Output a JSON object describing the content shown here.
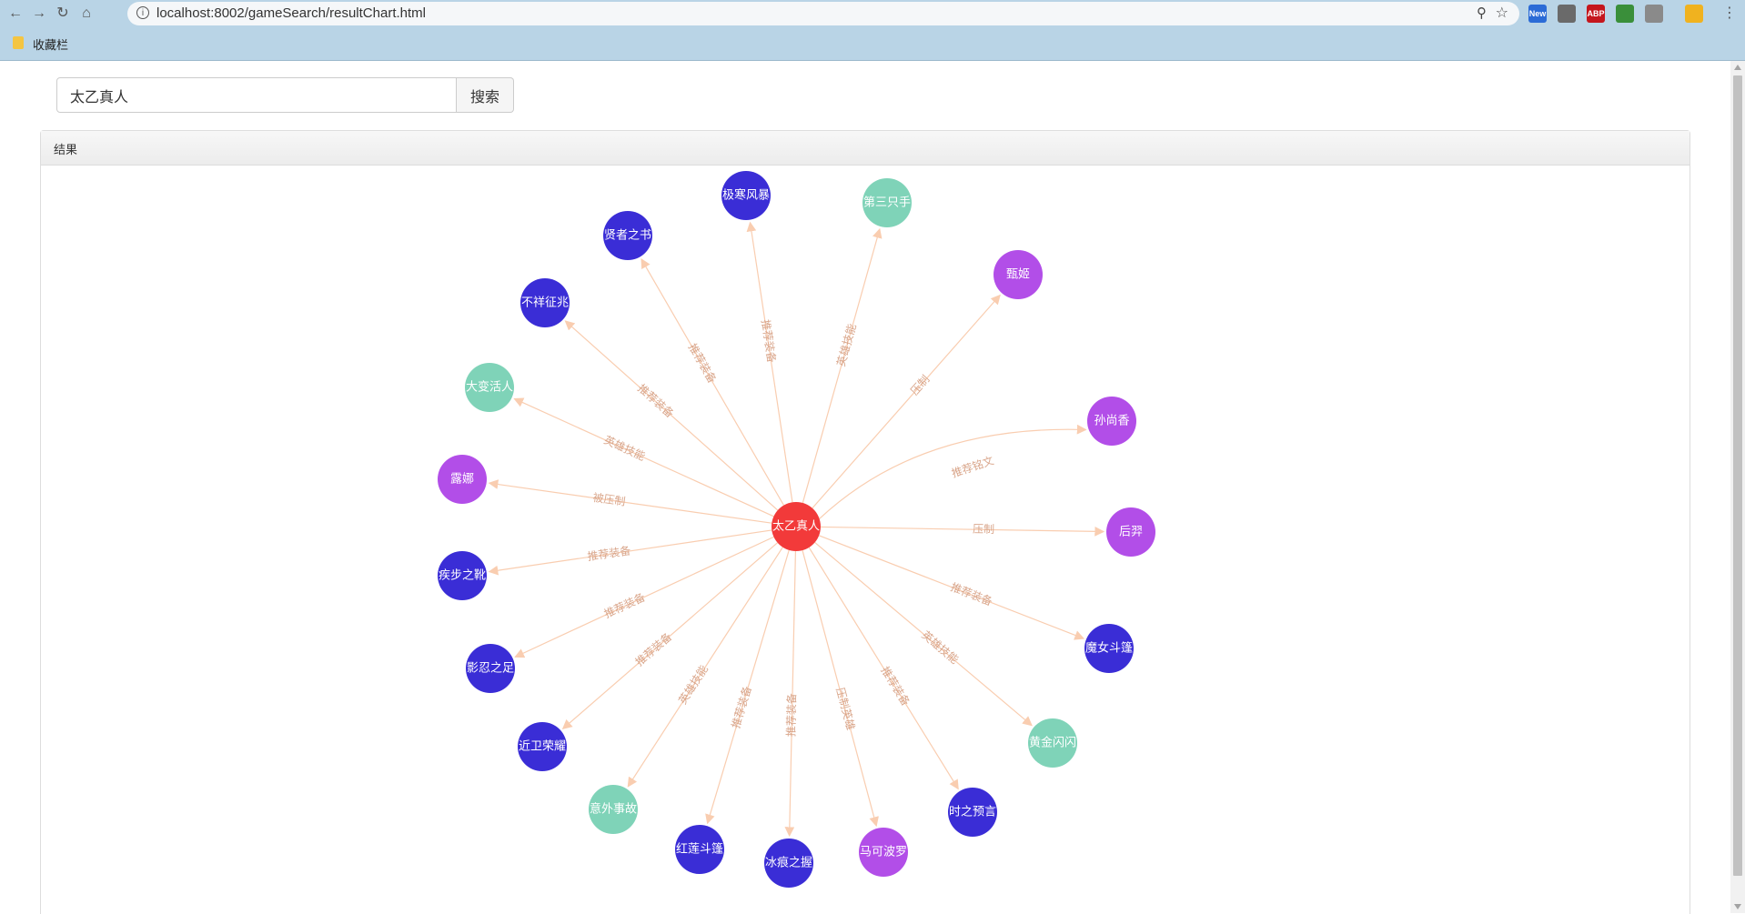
{
  "browser": {
    "url": "localhost:8002/gameSearch/resultChart.html",
    "bookmarks_folder": "收藏栏",
    "extensions": [
      {
        "name": "new-extension",
        "label": "New",
        "color": "#2b6bd6"
      },
      {
        "name": "chat-extension",
        "label": "",
        "color": "#6a6a6a"
      },
      {
        "name": "adblock-extension",
        "label": "ABP",
        "color": "#c5161d"
      },
      {
        "name": "globe-extension",
        "label": "",
        "color": "#3a8f3a"
      },
      {
        "name": "pdf-extension",
        "label": "",
        "color": "#8a8a8a"
      },
      {
        "name": "emoji-extension",
        "label": "",
        "color": "#f0b21f"
      }
    ]
  },
  "search": {
    "query": "太乙真人",
    "button_label": "搜索"
  },
  "panel": {
    "title": "结果"
  },
  "colors": {
    "center": "#f23a3a",
    "blue": "#3a2dd6",
    "green": "#7fd3b8",
    "purple": "#b24ee8",
    "edge": "#f9cdb0",
    "edge_label": "#d9a58a"
  },
  "graph": {
    "center": {
      "name": "太乙真人",
      "color": "center"
    },
    "nodes": [
      {
        "name": "极寒风暴",
        "color": "blue",
        "relation": "推荐装备"
      },
      {
        "name": "第三只手",
        "color": "green",
        "relation": "英雄技能"
      },
      {
        "name": "甄姬",
        "color": "purple",
        "relation": "压制"
      },
      {
        "name": "孙尚香",
        "color": "purple",
        "relation": "推荐铭文"
      },
      {
        "name": "后羿",
        "color": "purple",
        "relation": "压制"
      },
      {
        "name": "魔女斗篷",
        "color": "blue",
        "relation": "推荐装备"
      },
      {
        "name": "黄金闪闪",
        "color": "green",
        "relation": "英雄技能"
      },
      {
        "name": "时之预言",
        "color": "blue",
        "relation": "推荐装备"
      },
      {
        "name": "马可波罗",
        "color": "purple",
        "relation": "压制英雄"
      },
      {
        "name": "冰痕之握",
        "color": "blue",
        "relation": "推荐装备"
      },
      {
        "name": "红莲斗篷",
        "color": "blue",
        "relation": "推荐装备"
      },
      {
        "name": "意外事故",
        "color": "green",
        "relation": "英雄技能"
      },
      {
        "name": "近卫荣耀",
        "color": "blue",
        "relation": "推荐装备"
      },
      {
        "name": "影忍之足",
        "color": "blue",
        "relation": "推荐装备"
      },
      {
        "name": "疾步之靴",
        "color": "blue",
        "relation": "推荐装备"
      },
      {
        "name": "露娜",
        "color": "purple",
        "relation": "被压制"
      },
      {
        "name": "大变活人",
        "color": "green",
        "relation": "英雄技能"
      },
      {
        "name": "不祥征兆",
        "color": "blue",
        "relation": "推荐装备"
      },
      {
        "name": "贤者之书",
        "color": "blue",
        "relation": "推荐装备"
      }
    ]
  }
}
